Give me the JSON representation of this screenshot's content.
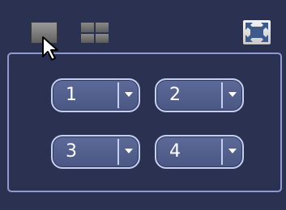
{
  "toolbar": {
    "single_layout_icon": "single-window-icon",
    "quad_layout_icon": "four-window-grid-icon",
    "fullscreen_icon": "fullscreen-icon"
  },
  "channels": [
    {
      "value": "1"
    },
    {
      "value": "2"
    },
    {
      "value": "3"
    },
    {
      "value": "4"
    }
  ],
  "colors": {
    "background": "#2b3150",
    "panel_border": "#8f9bd0",
    "select_fill": "#4a5683",
    "select_border": "#c5cff0",
    "text": "#ffffff"
  }
}
